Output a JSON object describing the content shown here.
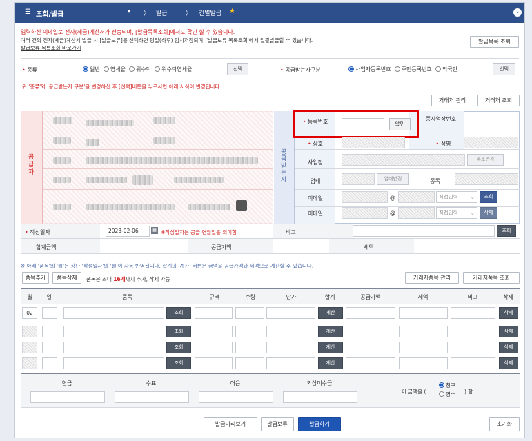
{
  "topbar": {
    "menu": "조회/발급",
    "crumb1": "발급",
    "crumb2": "건별발급",
    "collapse": "⌄"
  },
  "notice": {
    "line1": "입력하신 이메일로 전자(세금)계산서가 전송되며, [발급목록조회]에서도 확인 할 수 있습니다.",
    "line2": "여러 건의 전자(세금)계산서 발급 시 [발급보류]를 선택하면 당일(하루) 임시저장되며, '발급보류 목록조회'에서 일괄발급할 수 있습니다.",
    "link": "발급보류 목록조회 바로가기",
    "list_button": "발급목록 조회"
  },
  "type_row": {
    "label": "종류",
    "options": [
      "일반",
      "영세율",
      "위수탁",
      "위수탁영세율"
    ],
    "select_button": "선택",
    "receiver_label": "공급받는자구분",
    "receiver_options": [
      "사업자등록번호",
      "주민등록번호",
      "외국인"
    ],
    "receiver_select": "선택"
  },
  "type_notice": "위 '종류'와 '공급받는자 구분'을 변경하신 후 [선택]버튼을 누르시면 아래 서식이 변경됩니다.",
  "partner_buttons": {
    "manage": "거래처 관리",
    "lookup": "거래처 조회"
  },
  "supplier": {
    "side_label": "공급자"
  },
  "receiver": {
    "side_label": "공급받는자",
    "reg_label": "등록번호",
    "confirm": "확인",
    "sub_label": "종사업장번호",
    "name_label": "상호",
    "ceo_label": "성명",
    "addr_label": "사업장",
    "addr_button": "주소변경",
    "biz_label": "업태",
    "biz_button": "업태변경",
    "item_label": "종목",
    "email_label": "이메일",
    "email2_label": "이메일",
    "at": "@",
    "domain_select": "직접입력",
    "lookup": "조회",
    "delete": "삭제"
  },
  "date_row": {
    "label": "작성일자",
    "value": "2023-02-06",
    "hint": "※작성일자는 공급 연월일을 의미함",
    "remark_label": "비고",
    "lookup": "조회"
  },
  "totals": {
    "total_label": "합계금액",
    "supply_label": "공급가액",
    "tax_label": "세액"
  },
  "items_notice": "※ 아래 '품목'의 '월'은 상단 '작성일자'의 '월'이 자동 반영됩니다. 합계의 '계산' 버튼은 금액을 공급가액과 세액으로 계산할 수 있습니다.",
  "items_toolbar": {
    "add": "품목추가",
    "remove": "품목삭제",
    "hint_pre": "품목은 최대",
    "hint_max": "16개",
    "hint_post": "까지 추가, 삭제 가능",
    "manage": "거래처품목 관리",
    "lookup": "거래처품목 조회"
  },
  "items_header": [
    "월",
    "일",
    "품목",
    "규격",
    "수량",
    "단가",
    "합계",
    "공급가액",
    "세액",
    "비고",
    "삭제"
  ],
  "items_rows": [
    {
      "month": "02",
      "lookup": "조회",
      "calc": "계산",
      "del": "삭제"
    },
    {
      "month": "",
      "lookup": "조회",
      "calc": "계산",
      "del": "삭제"
    },
    {
      "month": "",
      "lookup": "조회",
      "calc": "계산",
      "del": "삭제"
    },
    {
      "month": "",
      "lookup": "조회",
      "calc": "계산",
      "del": "삭제"
    }
  ],
  "payment": {
    "headers": [
      "현금",
      "수표",
      "어음",
      "외상미수금"
    ],
    "amount_pre": "이 금액을 (",
    "amount_post": ") 함",
    "options": [
      "청구",
      "영수"
    ]
  },
  "footer": {
    "preview": "발급미리보기",
    "hold": "발급보류",
    "issue": "발급하기",
    "reset": "초기화"
  },
  "colors": {
    "topbar": "#2d4f8c",
    "issue": "#1f56b4",
    "highlight": "#e00000"
  }
}
